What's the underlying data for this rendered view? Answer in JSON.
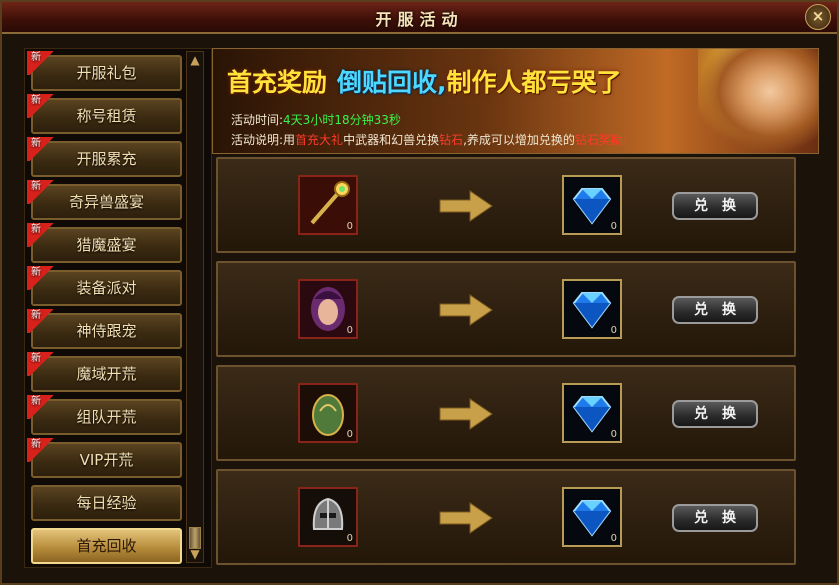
{
  "window": {
    "title": "开服活动",
    "close_glyph": "×"
  },
  "sidebar": {
    "new_badge": "新",
    "items": [
      {
        "label": "开服礼包",
        "new": true
      },
      {
        "label": "称号租赁",
        "new": true
      },
      {
        "label": "开服累充",
        "new": true
      },
      {
        "label": "奇异兽盛宴",
        "new": true
      },
      {
        "label": "猎魔盛宴",
        "new": true
      },
      {
        "label": "装备派对",
        "new": true
      },
      {
        "label": "神侍跟宠",
        "new": true
      },
      {
        "label": "魔域开荒",
        "new": true
      },
      {
        "label": "组队开荒",
        "new": true
      },
      {
        "label": "VIP开荒",
        "new": true
      },
      {
        "label": "每日经验",
        "new": false
      },
      {
        "label": "首充回收",
        "new": false,
        "active": true
      }
    ]
  },
  "banner": {
    "headline_part1": "首充奖励",
    "headline_part2": "倒贴回收,",
    "headline_part3": "制作人都亏哭了",
    "time_label": "活动时间:",
    "time_value": "4天3小时18分钟33秒",
    "desc_label": "活动说明:用",
    "desc_hl1": "首充大礼",
    "desc_mid": "中武器和幻兽兑换",
    "desc_hl2": "钻石",
    "desc_mid2": ",养成可以增加兑换的",
    "desc_hl3": "钻石奖励",
    "desc_end": "!"
  },
  "exchange_rows": [
    {
      "source_icon": "golden-staff-icon",
      "source_count": "0",
      "target_icon": "blue-diamond-icon",
      "target_count": "0",
      "button": "兑换"
    },
    {
      "source_icon": "pet-portrait-icon",
      "source_count": "0",
      "target_icon": "blue-diamond-icon",
      "target_count": "0",
      "button": "兑换"
    },
    {
      "source_icon": "beast-egg-icon",
      "source_count": "0",
      "target_icon": "blue-diamond-icon",
      "target_count": "0",
      "button": "兑换"
    },
    {
      "source_icon": "armored-helm-icon",
      "source_count": "0",
      "target_icon": "blue-diamond-icon",
      "target_count": "0",
      "button": "兑换"
    }
  ],
  "colors": {
    "accent_gold": "#e8c77a",
    "highlight_red": "#ff3a2a",
    "timer_green": "#3bf24a",
    "headline_yellow": "#ffe23a",
    "headline_blue": "#4dd8ff"
  }
}
